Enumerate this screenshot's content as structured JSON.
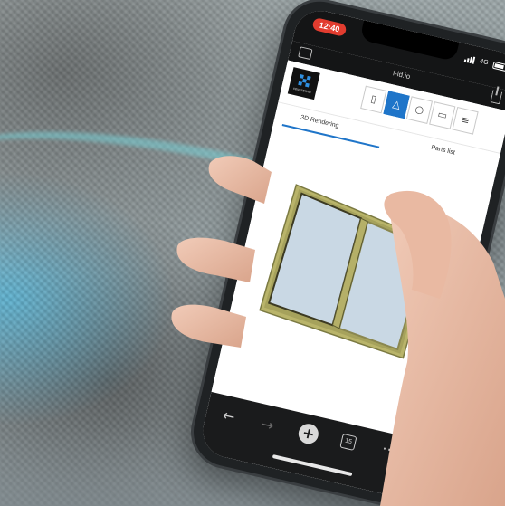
{
  "scene": {
    "description_icons": [
      "phone",
      "hand"
    ]
  },
  "status_bar": {
    "time": "12:40",
    "signal_label": "4G",
    "network": "4G"
  },
  "browser": {
    "url": "f-id.io",
    "tabs_count": "15",
    "nav": {
      "back_icon": "back-arrow-icon",
      "forward_icon": "forward-arrow-icon",
      "add_icon": "plus-icon",
      "more_icon": "more-dots-icon"
    }
  },
  "app": {
    "logo_text": "FENSTER-ID",
    "toolbar": [
      {
        "icon": "door-icon",
        "glyph": "▯",
        "active": false
      },
      {
        "icon": "warning-icon",
        "glyph": "△",
        "active": true
      },
      {
        "icon": "circle-icon",
        "glyph": "○",
        "active": false
      },
      {
        "icon": "document-icon",
        "glyph": "▭",
        "active": false
      },
      {
        "icon": "menu-icon",
        "glyph": "≡",
        "active": false
      }
    ],
    "tabs": [
      {
        "label": "3D Rendering",
        "active": true
      },
      {
        "label": "Parts list",
        "active": false
      }
    ]
  },
  "colors": {
    "accent": "#1f75c9",
    "status_red": "#e23c2f",
    "frame_gold": "#b9b46a",
    "glass": "#c9d8e4"
  }
}
